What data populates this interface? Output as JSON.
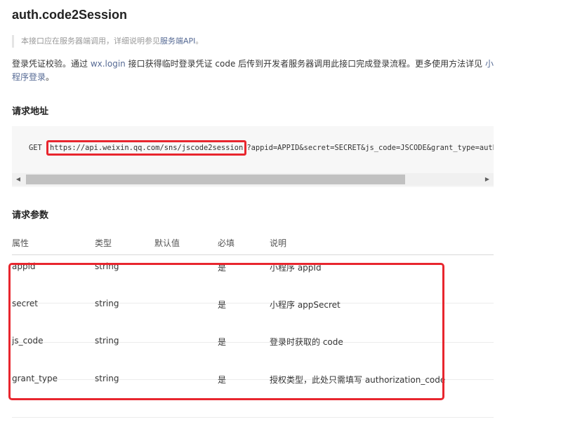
{
  "title": "auth.code2Session",
  "note": {
    "prefix": "本接口应在服务器端调用，详细说明参见",
    "link": "服务端API",
    "suffix": "。"
  },
  "description": {
    "part1": "登录凭证校验。通过 ",
    "link1": "wx.login",
    "part2": " 接口获得临时登录凭证 code 后传到开发者服务器调用此接口完成登录流程。更多使用方法详见 ",
    "link2": "小程序登录",
    "part3": "。"
  },
  "request_url": {
    "heading": "请求地址",
    "method": "GET",
    "url": "https://api.weixin.qq.com/sns/jscode2session",
    "query": "?appid=APPID&secret=SECRET&js_code=JSCODE&grant_type=authorization_code"
  },
  "params": {
    "heading": "请求参数",
    "columns": [
      "属性",
      "类型",
      "默认值",
      "必填",
      "说明"
    ],
    "rows": [
      {
        "name": "appid",
        "type": "string",
        "default": "",
        "required": "是",
        "desc": "小程序 appId"
      },
      {
        "name": "secret",
        "type": "string",
        "default": "",
        "required": "是",
        "desc": "小程序 appSecret"
      },
      {
        "name": "js_code",
        "type": "string",
        "default": "",
        "required": "是",
        "desc": "登录时获取的 code"
      },
      {
        "name": "grant_type",
        "type": "string",
        "default": "",
        "required": "是",
        "desc": "授权类型，此处只需填写 authorization_code"
      }
    ]
  },
  "colors": {
    "link": "#576b95",
    "highlight": "#e8262e",
    "code_bg": "#f7f7f7"
  }
}
